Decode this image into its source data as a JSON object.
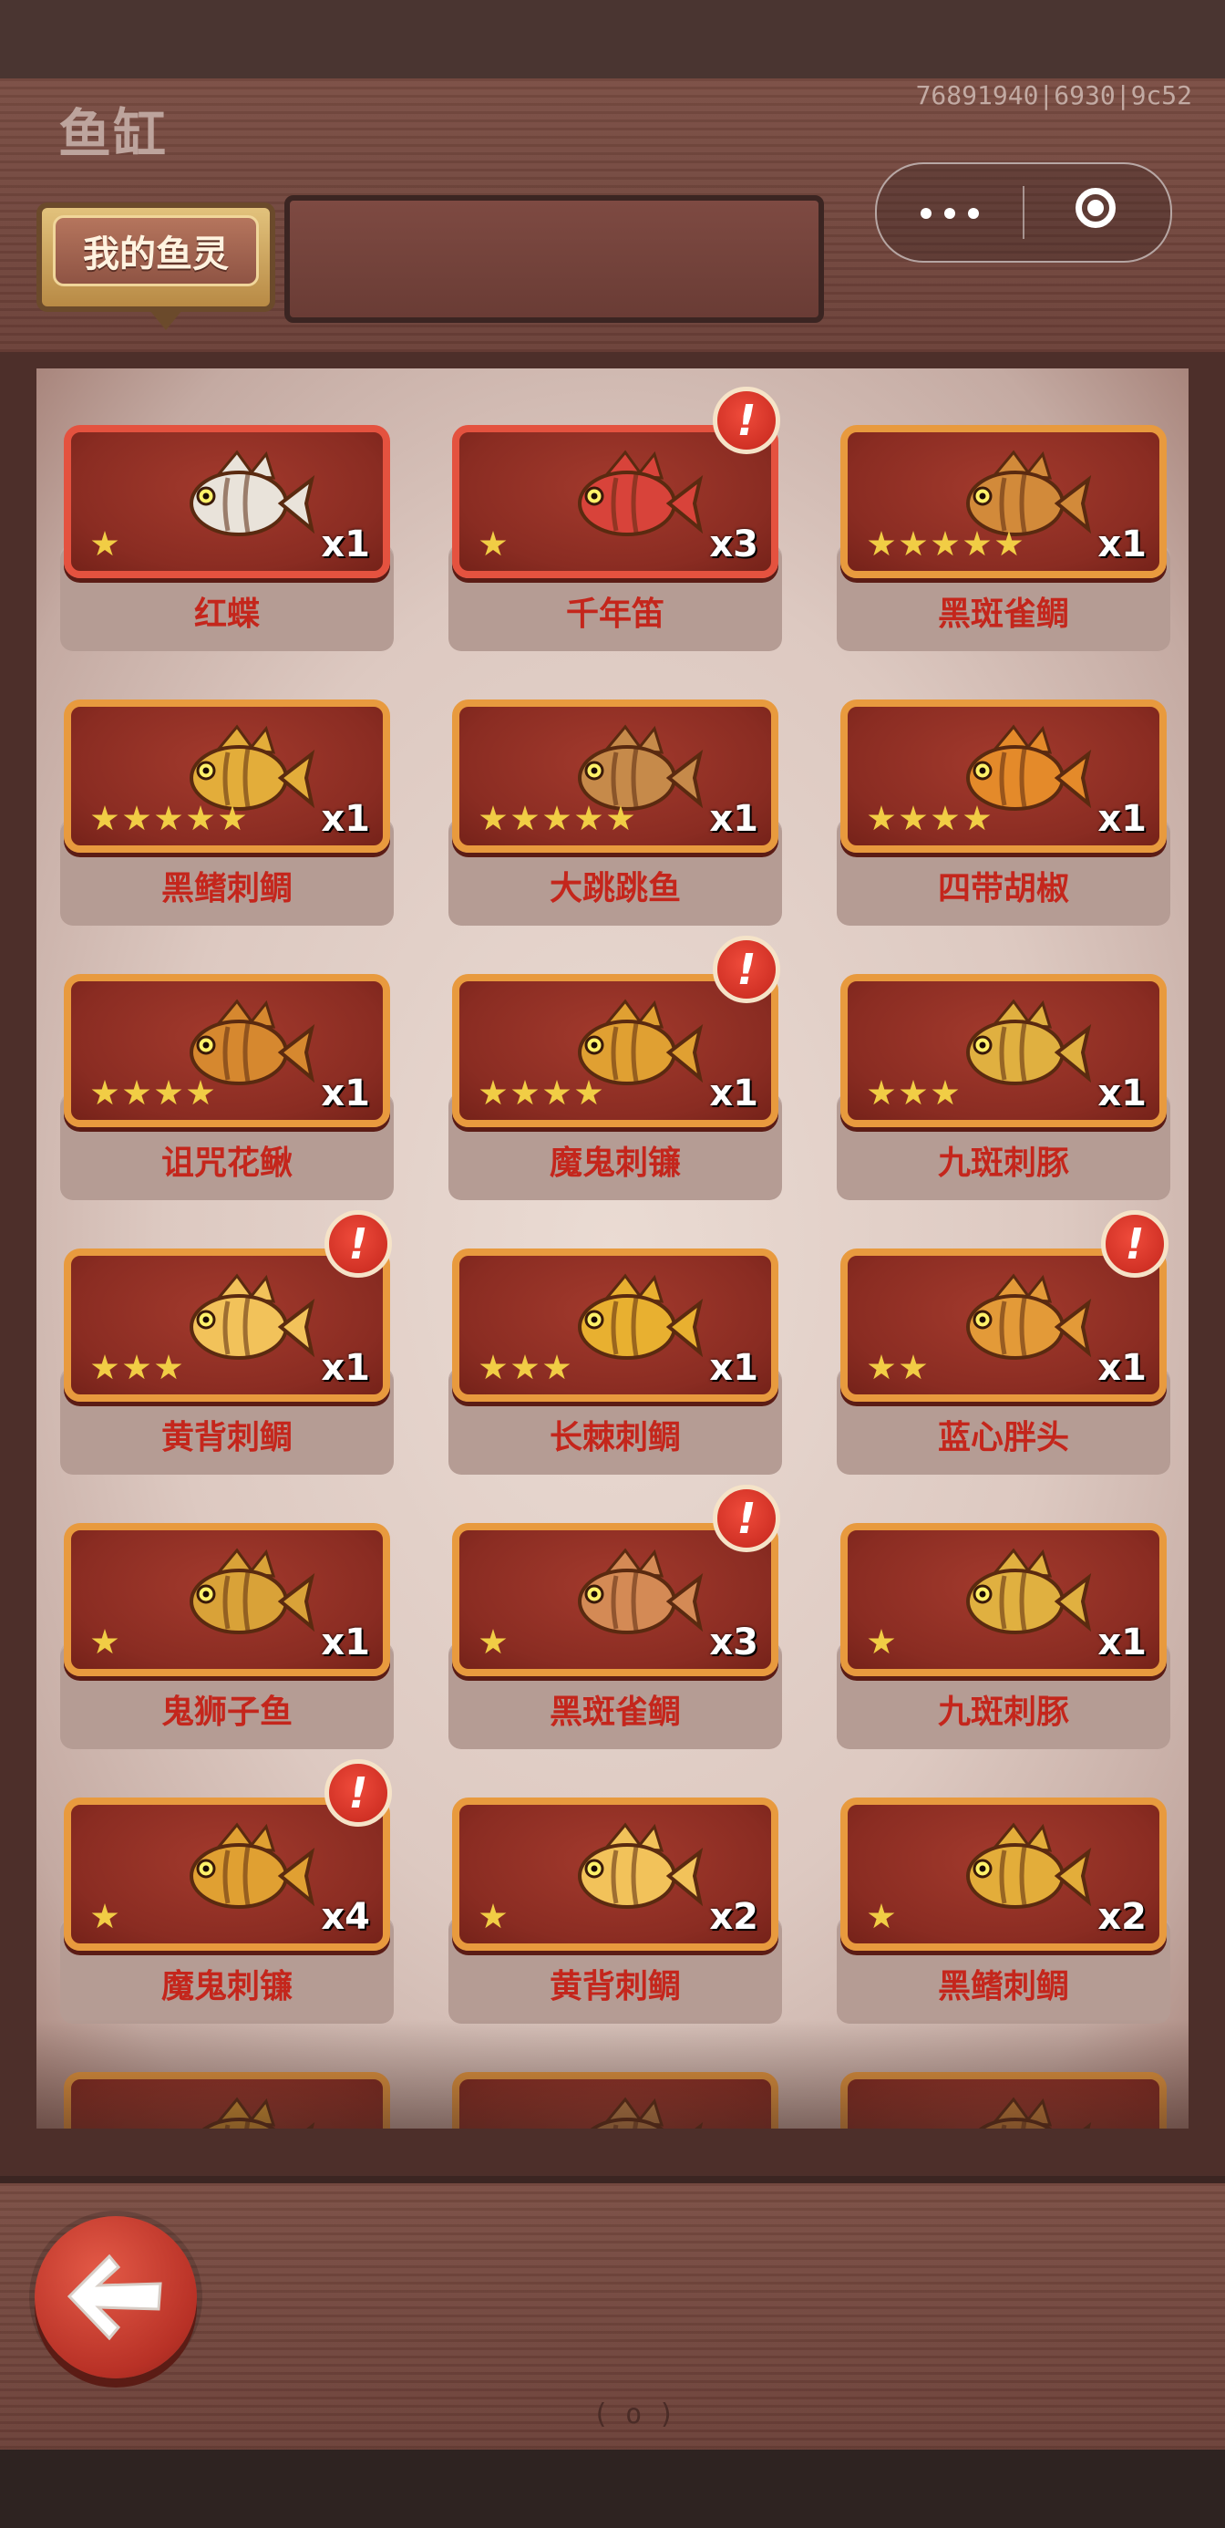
{
  "header": {
    "title": "鱼缸",
    "build_id": "76891940|6930|9c52",
    "tab_label": "我的鱼灵"
  },
  "capsule": {
    "more_icon": "more-dots-icon",
    "close_icon": "target-close-icon"
  },
  "colors": {
    "card_border_gold": "#e89a3e",
    "card_border_red": "#e4523f",
    "card_fill": "#8a2c22",
    "name_text": "#c4261c",
    "star": "#f1cd45",
    "badge": "#e03b2c"
  },
  "fish_items": [
    {
      "name": "红蝶",
      "count": "x1",
      "stars": 1,
      "rarity": "red",
      "badge": false,
      "fish_color": "#e9e3da"
    },
    {
      "name": "千年笛",
      "count": "x3",
      "stars": 1,
      "rarity": "red",
      "badge": true,
      "fish_color": "#d8433a"
    },
    {
      "name": "黑斑雀鲷",
      "count": "x1",
      "stars": 5,
      "rarity": "gold",
      "badge": false,
      "fish_color": "#d28a3a"
    },
    {
      "name": "黑鳍刺鲷",
      "count": "x1",
      "stars": 5,
      "rarity": "gold",
      "badge": false,
      "fish_color": "#e3ad3a"
    },
    {
      "name": "大跳跳鱼",
      "count": "x1",
      "stars": 5,
      "rarity": "gold",
      "badge": false,
      "fish_color": "#c68a4a"
    },
    {
      "name": "四带胡椒",
      "count": "x1",
      "stars": 4,
      "rarity": "gold",
      "badge": false,
      "fish_color": "#e48a2a"
    },
    {
      "name": "诅咒花鳅",
      "count": "x1",
      "stars": 4,
      "rarity": "gold",
      "badge": false,
      "fish_color": "#d6882f"
    },
    {
      "name": "魔鬼刺镰",
      "count": "x1",
      "stars": 4,
      "rarity": "gold",
      "badge": true,
      "fish_color": "#e0a032"
    },
    {
      "name": "九斑刺豚",
      "count": "x1",
      "stars": 3,
      "rarity": "gold",
      "badge": false,
      "fish_color": "#e0b040"
    },
    {
      "name": "黄背刺鲷",
      "count": "x1",
      "stars": 3,
      "rarity": "gold",
      "badge": true,
      "fish_color": "#f2c25a"
    },
    {
      "name": "长棘刺鲷",
      "count": "x1",
      "stars": 3,
      "rarity": "gold",
      "badge": false,
      "fish_color": "#e8b030"
    },
    {
      "name": "蓝心胖头",
      "count": "x1",
      "stars": 2,
      "rarity": "gold",
      "badge": true,
      "fish_color": "#e39a38"
    },
    {
      "name": "鬼狮子鱼",
      "count": "x1",
      "stars": 1,
      "rarity": "gold",
      "badge": false,
      "fish_color": "#d9a238"
    },
    {
      "name": "黑斑雀鲷",
      "count": "x3",
      "stars": 1,
      "rarity": "gold",
      "badge": true,
      "fish_color": "#d48a55"
    },
    {
      "name": "九斑刺豚",
      "count": "x1",
      "stars": 1,
      "rarity": "gold",
      "badge": false,
      "fish_color": "#e0b040"
    },
    {
      "name": "魔鬼刺镰",
      "count": "x4",
      "stars": 1,
      "rarity": "gold",
      "badge": true,
      "fish_color": "#e0a032"
    },
    {
      "name": "黄背刺鲷",
      "count": "x2",
      "stars": 1,
      "rarity": "gold",
      "badge": false,
      "fish_color": "#f2c25a"
    },
    {
      "name": "黑鳍刺鲷",
      "count": "x2",
      "stars": 1,
      "rarity": "gold",
      "badge": false,
      "fish_color": "#e3ad3a"
    },
    {
      "name": "",
      "count": "",
      "stars": 0,
      "rarity": "gold",
      "badge": false,
      "fish_color": "#e0a032"
    },
    {
      "name": "",
      "count": "",
      "stars": 0,
      "rarity": "gold",
      "badge": false,
      "fish_color": "#c68a4a"
    },
    {
      "name": "",
      "count": "",
      "stars": 0,
      "rarity": "gold",
      "badge": false,
      "fish_color": "#d28a3a"
    }
  ],
  "badge_glyph": "!",
  "footer": {
    "back_icon": "back-arrow-icon",
    "wood_mark": "( o )"
  }
}
